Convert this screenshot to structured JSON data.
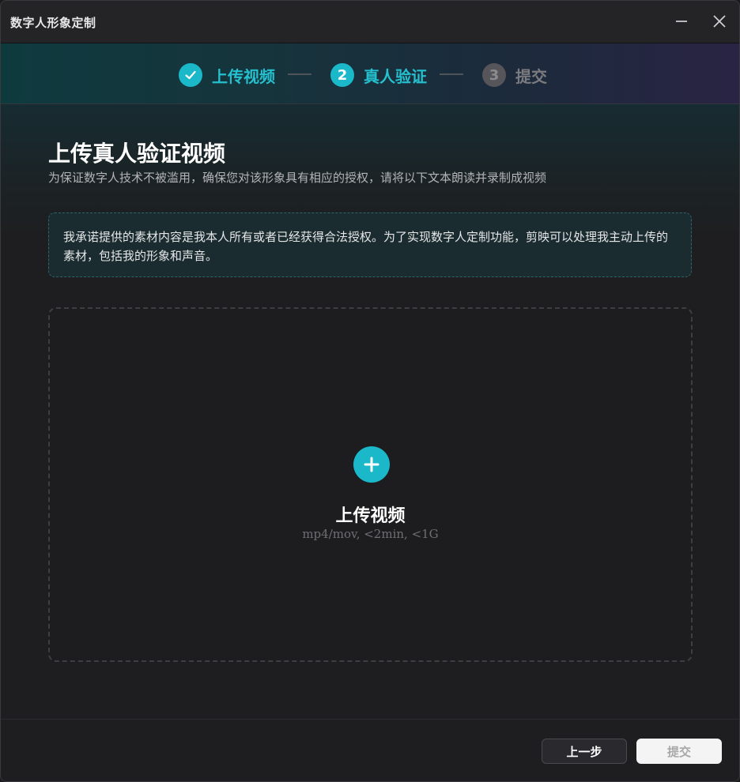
{
  "window": {
    "title": "数字人形象定制",
    "minimize_icon": "minimize-icon",
    "close_icon": "close-icon"
  },
  "stepper": {
    "steps": [
      {
        "number": "✓",
        "label": "上传视频",
        "state": "done",
        "icon": "check-icon"
      },
      {
        "number": "2",
        "label": "真人验证",
        "state": "active"
      },
      {
        "number": "3",
        "label": "提交",
        "state": "todo"
      }
    ]
  },
  "main": {
    "title": "上传真人验证视频",
    "subtitle": "为保证数字人技术不被滥用，确保您对该形象具有相应的授权，请将以下文本朗读并录制成视频",
    "statement": "我承诺提供的素材内容是我本人所有或者已经获得合法授权。为了实现数字人定制功能，剪映可以处理我主动上传的素材，包括我的形象和声音。"
  },
  "upload": {
    "icon": "plus-icon",
    "label": "上传视频",
    "hint": "mp4/mov, <2min, <1G"
  },
  "footer": {
    "prev_label": "上一步",
    "submit_label": "提交"
  },
  "colors": {
    "accent": "#1ab8c8",
    "background": "#1e1e20",
    "statement_border": "#2f6468"
  }
}
